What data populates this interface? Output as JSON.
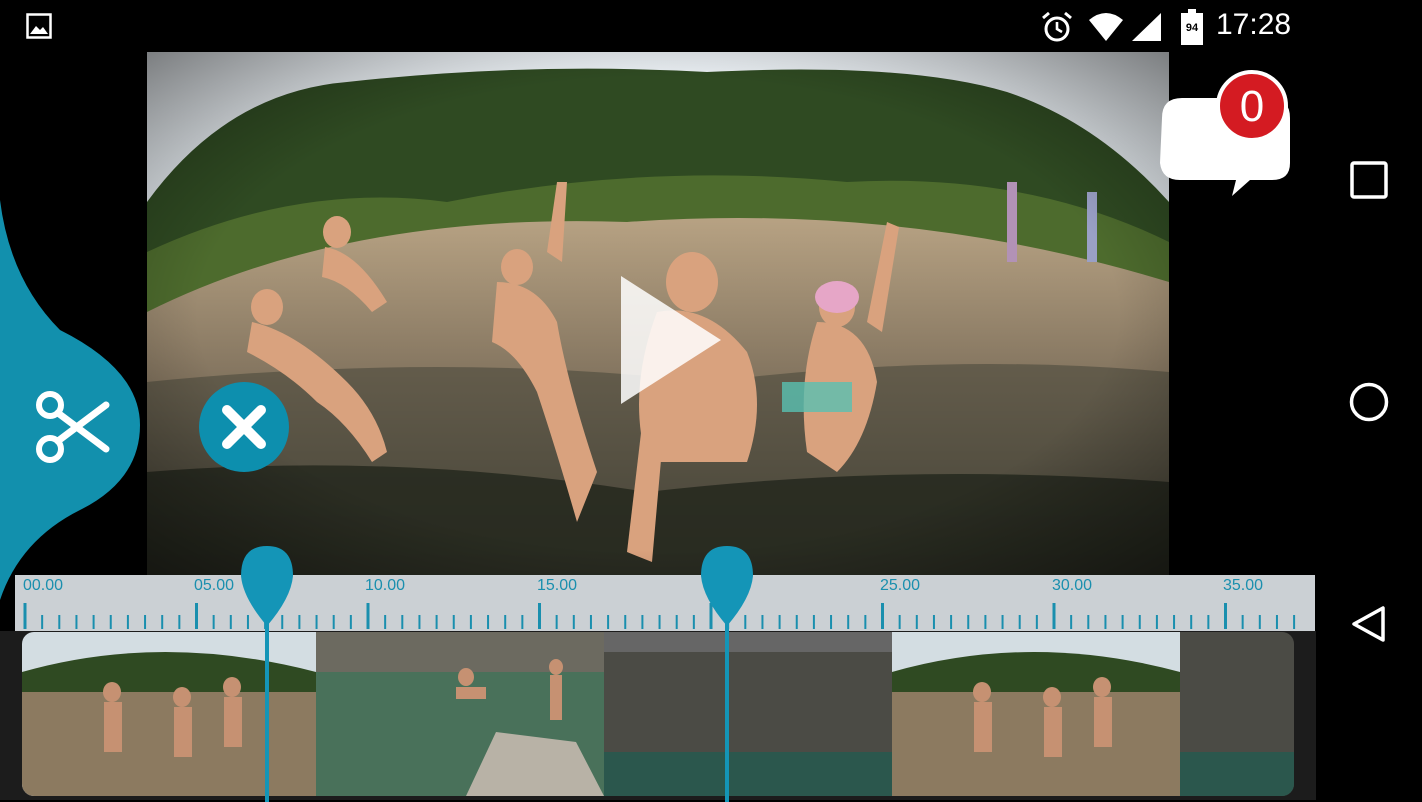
{
  "status_bar": {
    "time": "17:28",
    "battery": "94",
    "icons": [
      "gallery-icon",
      "alarm-icon",
      "wifi-icon",
      "signal-icon",
      "battery-icon"
    ]
  },
  "notification": {
    "count": "0"
  },
  "video": {
    "state": "paused"
  },
  "timeline": {
    "tick_labels": [
      "00.00",
      "05.00",
      "10.00",
      "15.00",
      "25.00",
      "30.00",
      "35.00"
    ],
    "trim_start": "06.20",
    "trim_end": "19.60"
  },
  "colors": {
    "accent": "#1495b7",
    "badge": "#d41b22",
    "ruler": "#dce2e6"
  }
}
